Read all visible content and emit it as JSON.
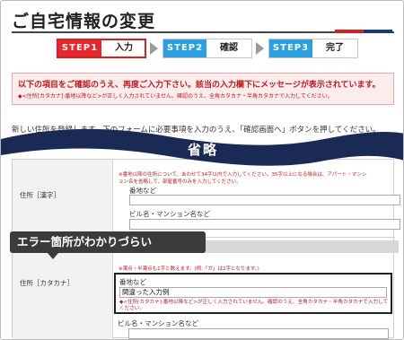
{
  "header": {
    "title": "ご自宅情報の変更",
    "accent_colors": [
      "#d81f26",
      "#1a3c7a"
    ]
  },
  "steps": [
    {
      "tag": "STEP1",
      "label": "入力",
      "state": "active",
      "color": "#e8262c"
    },
    {
      "tag": "STEP2",
      "label": "確認",
      "state": "inactive",
      "color": "#2b9fe0"
    },
    {
      "tag": "STEP3",
      "label": "完了",
      "state": "inactive",
      "color": "#2b9fe0"
    }
  ],
  "error_box": {
    "title": "以下の項目をご確認のうえ、再度ご入力下さい。該当の入力欄下にメッセージが表示されています。",
    "detail": "◆<住所[カタカナ]:番地以降など>が正しく入力されていません。確認のうえ、全角カタカナ・半角カタカナで入力してください。"
  },
  "intro": "新しい住所を登録します。下のフォームに必要事項を入力のうえ、「確認画面へ」ボタンを押してください。",
  "omitted_banner": "省略",
  "form": {
    "address_kanji": {
      "label": "住所［漢字］",
      "note_line1": "※番地以降の住所について、あわせて34字以内で入力してください。35字以上になる場合は、アパート・マンシ",
      "note_line2": "ョン名を省略して、部屋番号のみを入力してください。",
      "field1_label": "番地など",
      "field2_label": "ビル名・マンション名など"
    },
    "address_kana": {
      "label": "住所［カタカナ］",
      "note": "※濁点・半濁点も1字と数えます。(例:「ガ」は2字となります。)",
      "field1_label": "番地など",
      "field1_value": "間違った入力例",
      "field1_error": "◆<住所[カタカナ]:番地以降など>が正しく入力されていません。確認のうえ、全角カタカナ・半角カタカナで入力してください。",
      "field2_label": "ビル名・マンション名など"
    }
  },
  "callout": "エラー箇所がわかりづらい"
}
